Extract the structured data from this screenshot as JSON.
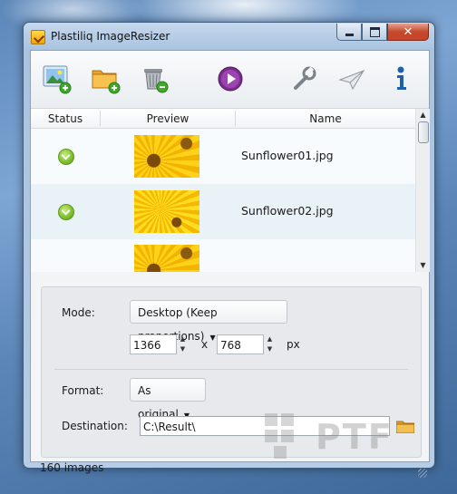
{
  "window": {
    "title": "Plastiliq ImageResizer"
  },
  "toolbar": {
    "buttons": [
      {
        "name": "add-image",
        "icon": "image-plus-icon"
      },
      {
        "name": "add-folder",
        "icon": "folder-plus-icon"
      },
      {
        "name": "remove",
        "icon": "trash-minus-icon"
      },
      {
        "name": "start",
        "icon": "play-icon"
      },
      {
        "name": "settings",
        "icon": "wrench-icon"
      },
      {
        "name": "send",
        "icon": "paper-plane-icon"
      },
      {
        "name": "info",
        "icon": "info-icon"
      }
    ]
  },
  "table": {
    "headers": {
      "status": "Status",
      "preview": "Preview",
      "name": "Name"
    },
    "rows": [
      {
        "status": "ok",
        "name": "Sunflower01.jpg"
      },
      {
        "status": "ok",
        "name": "Sunflower02.jpg"
      },
      {
        "status": "",
        "name": ""
      }
    ]
  },
  "settings": {
    "mode_label": "Mode:",
    "mode_value": "Desktop (Keep proportions)",
    "width": "1366",
    "x_sep": "x",
    "height": "768",
    "unit": "px",
    "format_label": "Format:",
    "format_value": "As original",
    "destination_label": "Destination:",
    "destination_value": "C:\\Result\\"
  },
  "statusbar": {
    "count": "160 images"
  },
  "watermark": {
    "text": "PTF"
  },
  "colors": {
    "accent_green": "#7bbf2c",
    "close_red": "#c44a2c",
    "play_purple": "#7a2d8c"
  }
}
